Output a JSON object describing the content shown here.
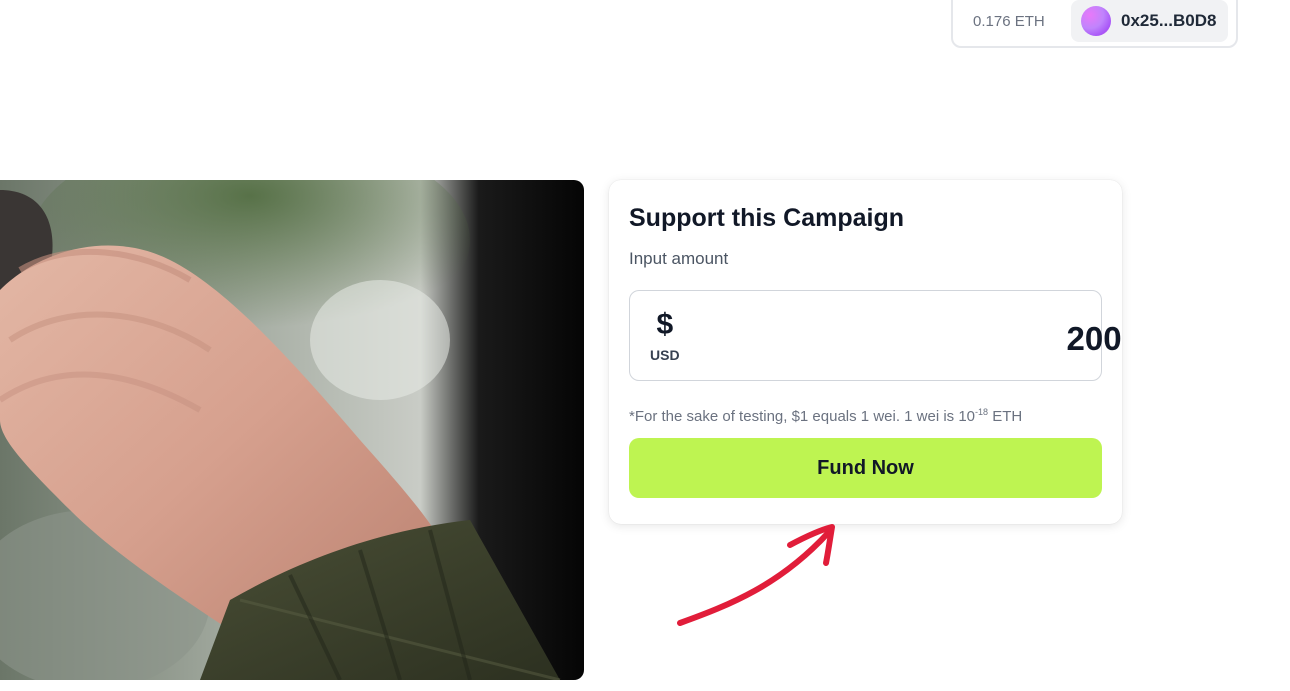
{
  "wallet": {
    "balance": "0.176 ETH",
    "address": "0x25...B0D8"
  },
  "campaign_image": {
    "description_icon": "hand-photo"
  },
  "support_card": {
    "title": "Support this Campaign",
    "subtitle": "Input amount",
    "currency_symbol": "$",
    "currency_code": "USD",
    "amount_value": "200",
    "note_prefix": "*For the sake of testing, $1 equals 1 wei. 1 wei is 10",
    "note_exponent": "-18",
    "note_suffix": " ETH",
    "fund_button_label": "Fund Now"
  },
  "colors": {
    "fund_button": "#bef451",
    "annotation_arrow": "#e11d3a"
  }
}
